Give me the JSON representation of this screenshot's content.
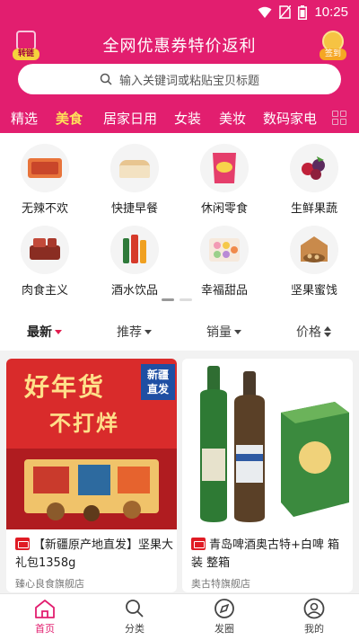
{
  "status_bar": {
    "time": "10:25"
  },
  "header": {
    "title": "全网优惠券特价返利",
    "left_badge": "转链",
    "right_badge": "签到",
    "accent": "#e21e6f"
  },
  "search": {
    "placeholder": "输入关键词或粘贴宝贝标题"
  },
  "categories": [
    "精选",
    "美食",
    "居家日用",
    "女装",
    "美妆",
    "数码家电"
  ],
  "active_category": "美食",
  "grid": [
    {
      "label": "无辣不欢",
      "icon": "spicy-snack-icon"
    },
    {
      "label": "快捷早餐",
      "icon": "bread-icon"
    },
    {
      "label": "休闲零食",
      "icon": "chips-icon"
    },
    {
      "label": "生鲜果蔬",
      "icon": "berries-icon"
    },
    {
      "label": "肉食主义",
      "icon": "meat-icon"
    },
    {
      "label": "酒水饮品",
      "icon": "bottles-icon"
    },
    {
      "label": "幸福甜品",
      "icon": "macaron-icon"
    },
    {
      "label": "坚果蜜饯",
      "icon": "nuts-icon"
    }
  ],
  "sort": {
    "latest": "最新",
    "recommend": "推荐",
    "sales": "销量",
    "price": "价格"
  },
  "products": [
    {
      "title": "【新疆原产地直发】坚果大礼包1358g",
      "shop": "臻心良食旗舰店",
      "banner_main": "好年货",
      "banner_sub": "不打烊",
      "banner_tag": "新疆直发"
    },
    {
      "title": "青岛啤酒奥古特+白啤 箱装 整箱",
      "shop": "奥古特旗舰店"
    }
  ],
  "bottom_nav": [
    "首页",
    "分类",
    "发圈",
    "我的"
  ]
}
